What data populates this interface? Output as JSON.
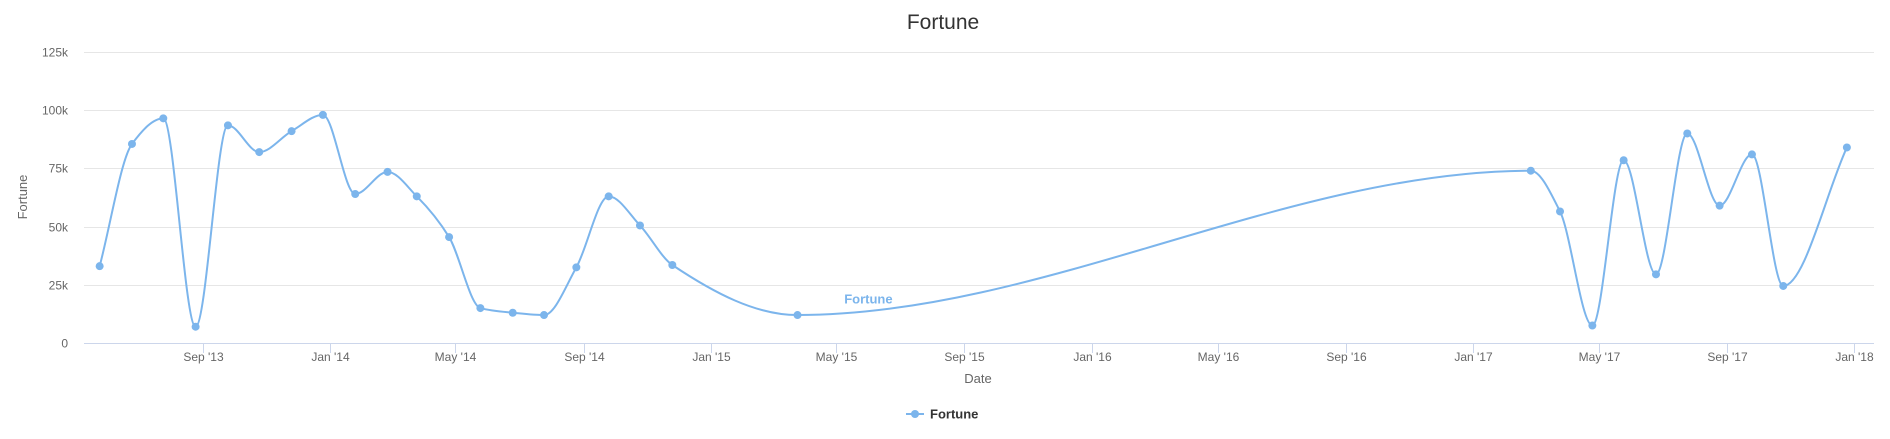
{
  "chart_data": {
    "type": "line",
    "title": "Fortune",
    "xlabel": "Date",
    "ylabel": "Fortune",
    "ylim": [
      0,
      125000
    ],
    "y_ticks": [
      {
        "value": 0,
        "label": "0"
      },
      {
        "value": 25000,
        "label": "25k"
      },
      {
        "value": 50000,
        "label": "50k"
      },
      {
        "value": 75000,
        "label": "75k"
      },
      {
        "value": 100000,
        "label": "100k"
      },
      {
        "value": 125000,
        "label": "125k"
      }
    ],
    "xlim": [
      "2013-05-10",
      "2018-01-20"
    ],
    "x_ticks": [
      {
        "value": "2013-09-01",
        "label": "Sep '13"
      },
      {
        "value": "2014-01-01",
        "label": "Jan '14"
      },
      {
        "value": "2014-05-01",
        "label": "May '14"
      },
      {
        "value": "2014-09-01",
        "label": "Sep '14"
      },
      {
        "value": "2015-01-01",
        "label": "Jan '15"
      },
      {
        "value": "2015-05-01",
        "label": "May '15"
      },
      {
        "value": "2015-09-01",
        "label": "Sep '15"
      },
      {
        "value": "2016-01-01",
        "label": "Jan '16"
      },
      {
        "value": "2016-05-01",
        "label": "May '16"
      },
      {
        "value": "2016-09-01",
        "label": "Sep '16"
      },
      {
        "value": "2017-01-01",
        "label": "Jan '17"
      },
      {
        "value": "2017-05-01",
        "label": "May '17"
      },
      {
        "value": "2017-09-01",
        "label": "Sep '17"
      },
      {
        "value": "2018-01-01",
        "label": "Jan '18"
      }
    ],
    "grid": true,
    "legend_position": "bottom-center",
    "series": [
      {
        "name": "Fortune",
        "color": "#7cb5ec",
        "points": [
          {
            "x": "2013-05-25",
            "y": 33000
          },
          {
            "x": "2013-06-25",
            "y": 85500
          },
          {
            "x": "2013-07-25",
            "y": 96500
          },
          {
            "x": "2013-08-25",
            "y": 7000
          },
          {
            "x": "2013-09-25",
            "y": 93500
          },
          {
            "x": "2013-10-25",
            "y": 82000
          },
          {
            "x": "2013-11-25",
            "y": 91000
          },
          {
            "x": "2013-12-25",
            "y": 98000
          },
          {
            "x": "2014-01-25",
            "y": 64000
          },
          {
            "x": "2014-02-25",
            "y": 73500
          },
          {
            "x": "2014-03-25",
            "y": 63000
          },
          {
            "x": "2014-04-25",
            "y": 45500
          },
          {
            "x": "2014-05-25",
            "y": 15000
          },
          {
            "x": "2014-06-25",
            "y": 13000
          },
          {
            "x": "2014-07-25",
            "y": 12000
          },
          {
            "x": "2014-08-25",
            "y": 32500
          },
          {
            "x": "2014-09-25",
            "y": 63000
          },
          {
            "x": "2014-10-25",
            "y": 50500
          },
          {
            "x": "2014-11-25",
            "y": 33500
          },
          {
            "x": "2015-03-25",
            "y": 12000
          },
          {
            "x": "2017-02-25",
            "y": 74000
          },
          {
            "x": "2017-03-25",
            "y": 56500
          },
          {
            "x": "2017-04-25",
            "y": 7500
          },
          {
            "x": "2017-05-25",
            "y": 78500
          },
          {
            "x": "2017-06-25",
            "y": 29500
          },
          {
            "x": "2017-07-25",
            "y": 90000
          },
          {
            "x": "2017-08-25",
            "y": 59000
          },
          {
            "x": "2017-09-25",
            "y": 81000
          },
          {
            "x": "2017-10-25",
            "y": 24500
          },
          {
            "x": "2017-12-25",
            "y": 84000
          }
        ],
        "label_anchor": {
          "x": "2015-06-01",
          "y": 17000
        }
      }
    ]
  }
}
